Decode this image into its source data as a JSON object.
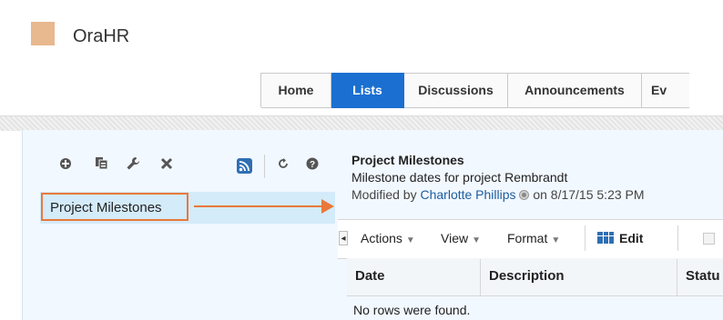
{
  "app": {
    "brand": "OraHR",
    "logo_color": "#e8b88f",
    "accent": "#1a6fd1",
    "highlight": "#e8793a"
  },
  "tabs": [
    {
      "label": "Home",
      "active": false
    },
    {
      "label": "Lists",
      "active": true
    },
    {
      "label": "Discussions",
      "active": false
    },
    {
      "label": "Announcements",
      "active": false
    },
    {
      "label": "Ev",
      "active": false
    }
  ],
  "left_toolbar": {
    "icons": [
      "add-icon",
      "copy-icon",
      "wrench-icon",
      "delete-icon",
      "rss-icon",
      "refresh-icon",
      "help-icon"
    ]
  },
  "left_list": {
    "selected_item": "Project Milestones"
  },
  "detail": {
    "title": "Project Milestones",
    "description": "Milestone dates for project Rembrandt",
    "modified_prefix": "Modified by",
    "modified_by": "Charlotte Phillips",
    "modified_on": "on 8/17/15 5:23 PM"
  },
  "table_toolbar": {
    "actions": "Actions",
    "view": "View",
    "format": "Format",
    "edit": "Edit"
  },
  "table": {
    "columns": [
      "Date",
      "Description",
      "Statu"
    ],
    "empty_message": "No rows were found."
  }
}
